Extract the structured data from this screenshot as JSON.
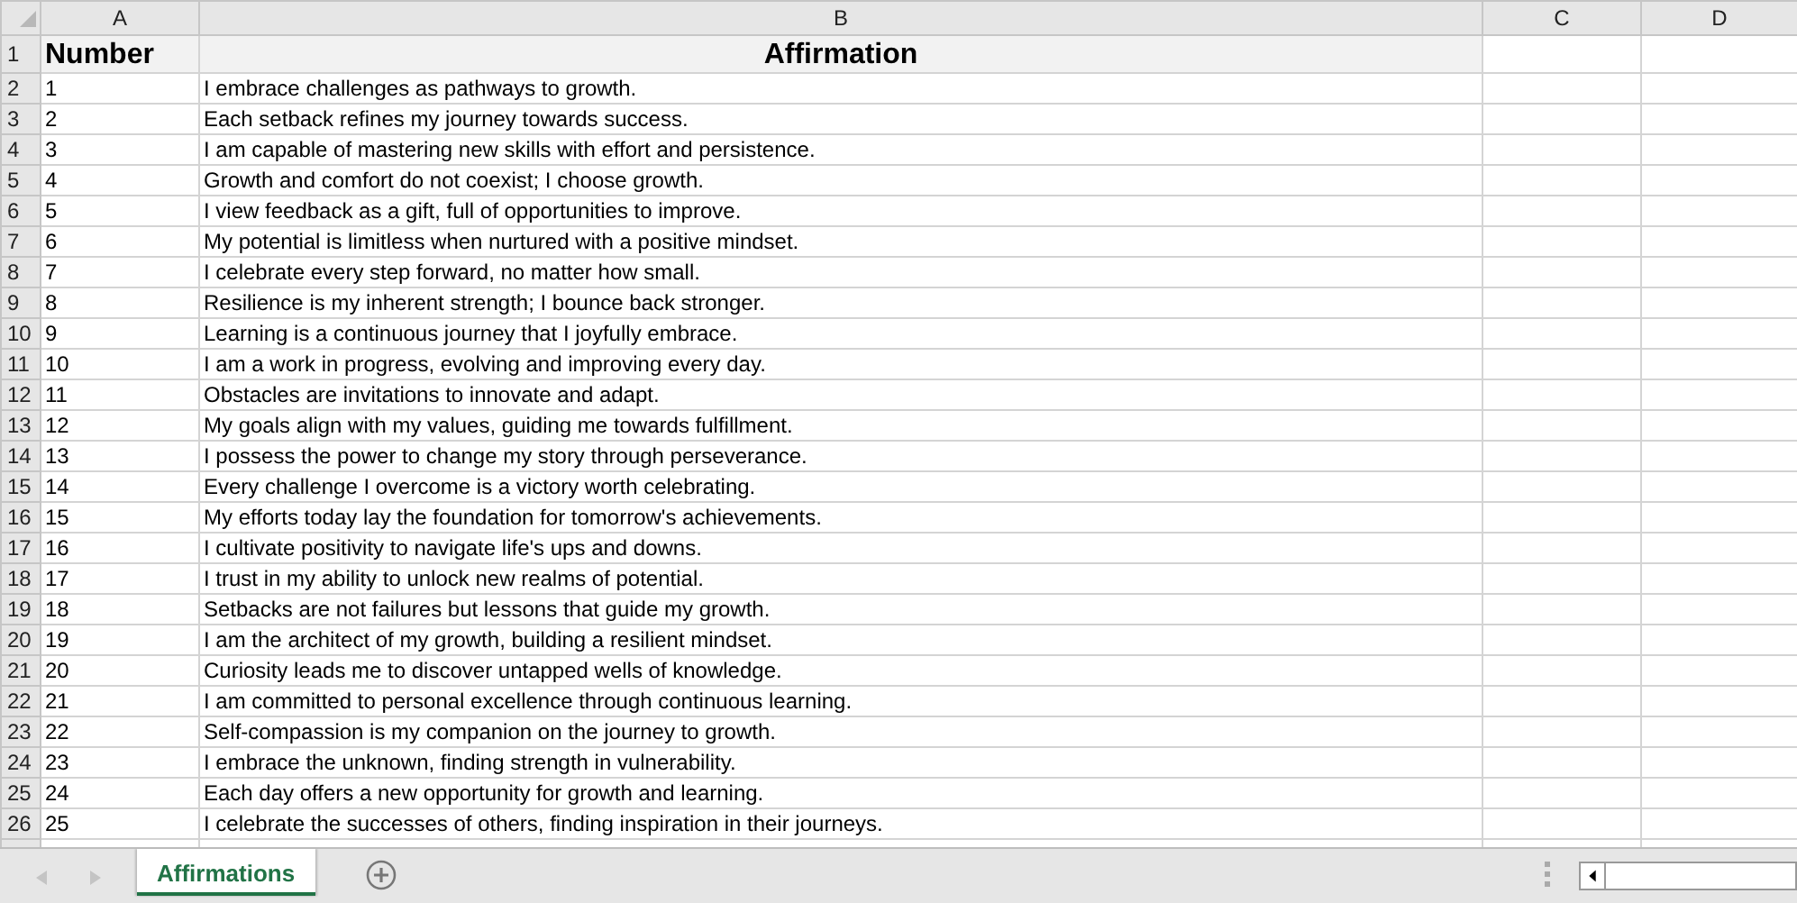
{
  "columns": [
    "A",
    "B",
    "C",
    "D"
  ],
  "header": {
    "row": "1",
    "cells": [
      "Number",
      "Affirmation"
    ]
  },
  "rows": [
    {
      "row": "2",
      "number": "1",
      "text": "I embrace challenges as pathways to growth."
    },
    {
      "row": "3",
      "number": "2",
      "text": "Each setback refines my journey towards success."
    },
    {
      "row": "4",
      "number": "3",
      "text": "I am capable of mastering new skills with effort and persistence."
    },
    {
      "row": "5",
      "number": "4",
      "text": "Growth and comfort do not coexist; I choose growth."
    },
    {
      "row": "6",
      "number": "5",
      "text": "I view feedback as a gift, full of opportunities to improve."
    },
    {
      "row": "7",
      "number": "6",
      "text": "My potential is limitless when nurtured with a positive mindset."
    },
    {
      "row": "8",
      "number": "7",
      "text": "I celebrate every step forward, no matter how small."
    },
    {
      "row": "9",
      "number": "8",
      "text": "Resilience is my inherent strength; I bounce back stronger."
    },
    {
      "row": "10",
      "number": "9",
      "text": "Learning is a continuous journey that I joyfully embrace."
    },
    {
      "row": "11",
      "number": "10",
      "text": "I am a work in progress, evolving and improving every day."
    },
    {
      "row": "12",
      "number": "11",
      "text": "Obstacles are invitations to innovate and adapt."
    },
    {
      "row": "13",
      "number": "12",
      "text": "My goals align with my values, guiding me towards fulfillment."
    },
    {
      "row": "14",
      "number": "13",
      "text": "I possess the power to change my story through perseverance."
    },
    {
      "row": "15",
      "number": "14",
      "text": "Every challenge I overcome is a victory worth celebrating."
    },
    {
      "row": "16",
      "number": "15",
      "text": "My efforts today lay the foundation for tomorrow's achievements."
    },
    {
      "row": "17",
      "number": "16",
      "text": "I cultivate positivity to navigate life's ups and downs."
    },
    {
      "row": "18",
      "number": "17",
      "text": "I trust in my ability to unlock new realms of potential."
    },
    {
      "row": "19",
      "number": "18",
      "text": "Setbacks are not failures but lessons that guide my growth."
    },
    {
      "row": "20",
      "number": "19",
      "text": "I am the architect of my growth, building a resilient mindset."
    },
    {
      "row": "21",
      "number": "20",
      "text": "Curiosity leads me to discover untapped wells of knowledge."
    },
    {
      "row": "22",
      "number": "21",
      "text": "I am committed to personal excellence through continuous learning."
    },
    {
      "row": "23",
      "number": "22",
      "text": "Self-compassion is my companion on the journey to growth."
    },
    {
      "row": "24",
      "number": "23",
      "text": "I embrace the unknown, finding strength in vulnerability."
    },
    {
      "row": "25",
      "number": "24",
      "text": "Each day offers a new opportunity for growth and learning."
    },
    {
      "row": "26",
      "number": "25",
      "text": "I celebrate the successes of others, finding inspiration in their journeys."
    }
  ],
  "sheet_tabs": [
    {
      "label": "Affirmations",
      "selected": true
    }
  ]
}
